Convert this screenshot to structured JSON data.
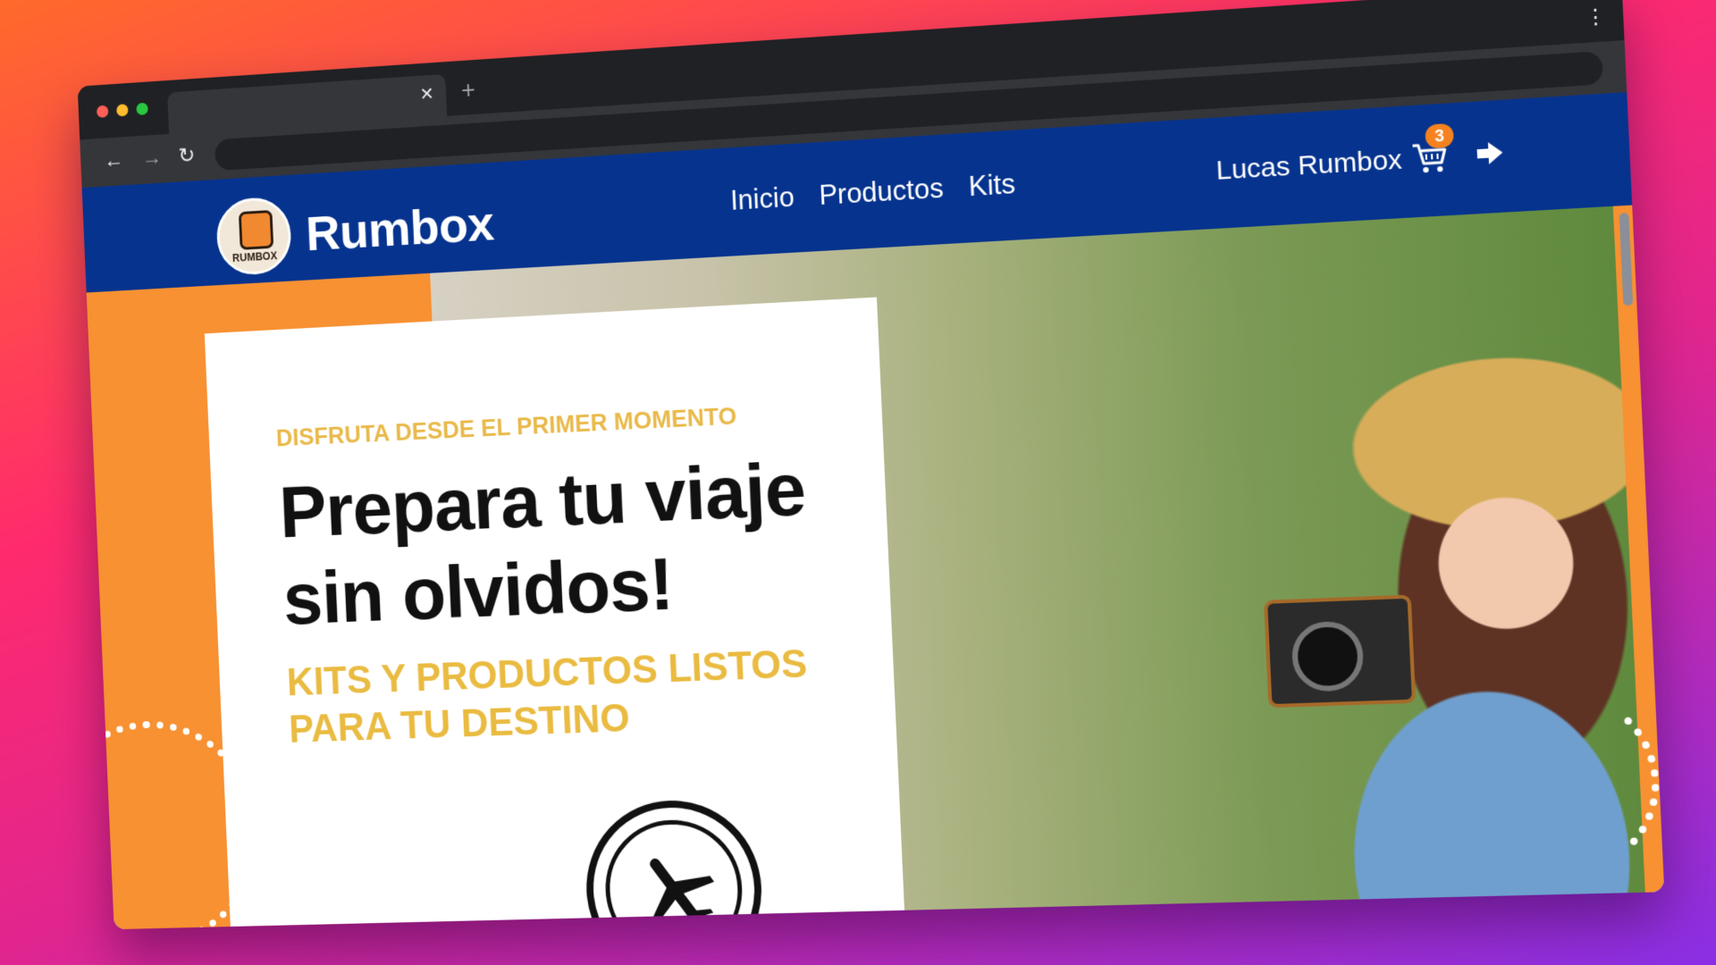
{
  "browser": {
    "tab_close_glyph": "✕",
    "new_tab_glyph": "+",
    "menu_glyph": "⋮",
    "back_glyph": "←",
    "forward_glyph": "→",
    "reload_glyph": "↻",
    "colors": {
      "close": "#ff5f57",
      "minimize": "#febc2e",
      "maximize": "#28c840"
    }
  },
  "site": {
    "brand": "Rumbox",
    "logo_text": "RUMBOX",
    "nav": [
      "Inicio",
      "Productos",
      "Kits"
    ],
    "user_name": "Lucas Rumbox",
    "cart_count": "3",
    "colors": {
      "header": "#06338e",
      "accent": "#f79132",
      "gold": "#e9b949"
    }
  },
  "hero": {
    "kicker": "DISFRUTA DESDE EL PRIMER MOMENTO",
    "headline": "Prepara tu viaje sin olvidos!",
    "subheadline": "KITS Y PRODUCTOS LISTOS PARA TU DESTINO",
    "icons": [
      "airplane-icon",
      "camera"
    ]
  }
}
